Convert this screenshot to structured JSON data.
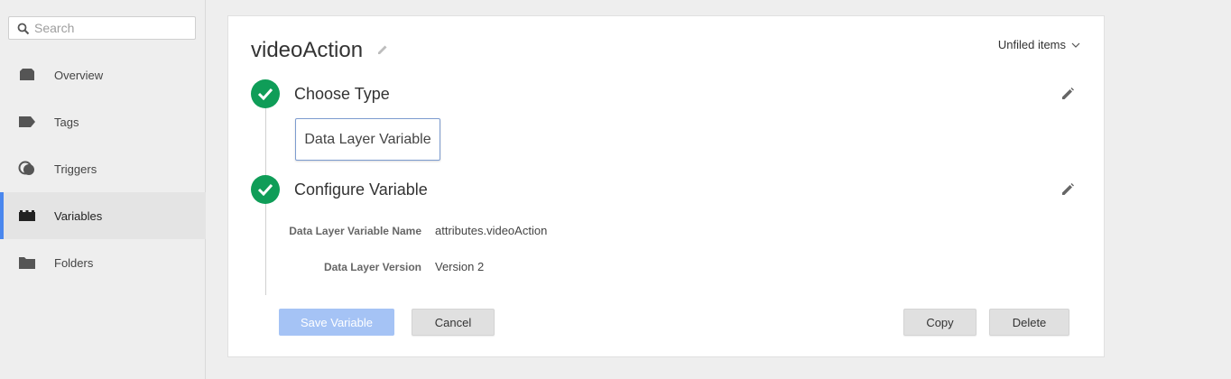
{
  "search": {
    "placeholder": "Search",
    "value": ""
  },
  "sidebar": {
    "items": [
      {
        "label": "Overview",
        "icon": "overview-icon",
        "active": false
      },
      {
        "label": "Tags",
        "icon": "tag-icon",
        "active": false
      },
      {
        "label": "Triggers",
        "icon": "trigger-icon",
        "active": false
      },
      {
        "label": "Variables",
        "icon": "variables-icon",
        "active": true
      },
      {
        "label": "Folders",
        "icon": "folder-icon",
        "active": false
      }
    ],
    "active_color": "#4a87ee"
  },
  "editor": {
    "title": "videoAction",
    "folder_dropdown": "Unfiled items",
    "step1": {
      "title": "Choose Type",
      "type_value": "Data Layer Variable"
    },
    "step2": {
      "title": "Configure Variable",
      "fields": [
        {
          "label": "Data Layer Variable Name",
          "value": "attributes.videoAction"
        },
        {
          "label": "Data Layer Version",
          "value": "Version 2"
        }
      ]
    },
    "check_color": "#0f9d58"
  },
  "actions": {
    "save": "Save Variable",
    "cancel": "Cancel",
    "copy": "Copy",
    "delete": "Delete"
  }
}
